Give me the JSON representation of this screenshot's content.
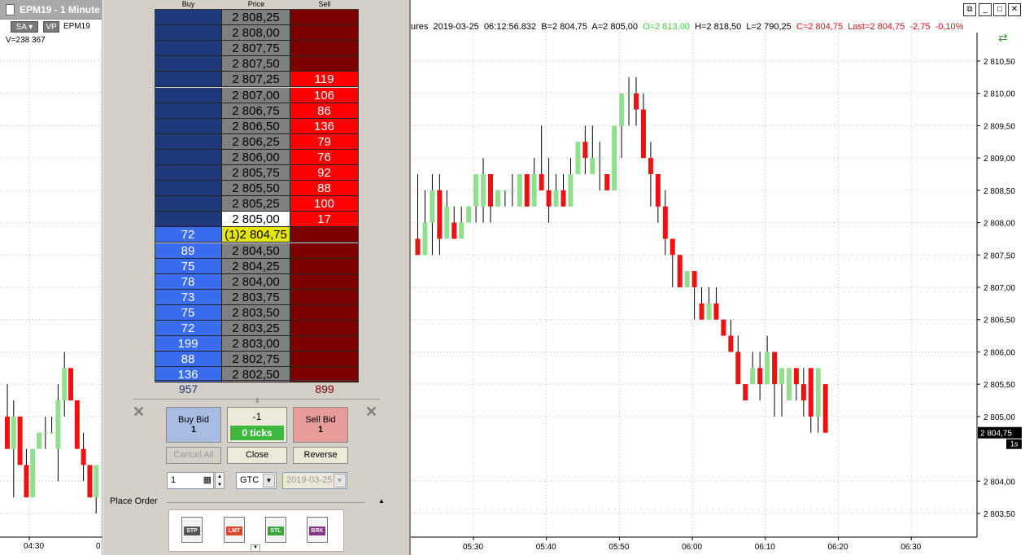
{
  "left_chart": {
    "title": "EPM19 - 1 Minute",
    "btn_sa": "SA",
    "btn_vp": "VP",
    "symbol": "EPM19",
    "volume": "V=238 367",
    "time_labels": [
      "04:30",
      "0"
    ]
  },
  "dom": {
    "headers": {
      "buy": "Buy",
      "price": "Price",
      "sell": "Sell"
    },
    "rows": [
      {
        "buy": "",
        "price": "2 808,25",
        "sell": ""
      },
      {
        "buy": "",
        "price": "2 808,00",
        "sell": ""
      },
      {
        "buy": "",
        "price": "2 807,75",
        "sell": ""
      },
      {
        "buy": "",
        "price": "2 807,50",
        "sell": ""
      },
      {
        "buy": "",
        "price": "2 807,25",
        "sell": "119"
      },
      {
        "buy": "",
        "price": "2 807,00",
        "sell": "106"
      },
      {
        "buy": "",
        "price": "2 806,75",
        "sell": "86"
      },
      {
        "buy": "",
        "price": "2 806,50",
        "sell": "136"
      },
      {
        "buy": "",
        "price": "2 806,25",
        "sell": "79"
      },
      {
        "buy": "",
        "price": "2 806,00",
        "sell": "76"
      },
      {
        "buy": "",
        "price": "2 805,75",
        "sell": "92"
      },
      {
        "buy": "",
        "price": "2 805,50",
        "sell": "88"
      },
      {
        "buy": "",
        "price": "2 805,25",
        "sell": "100"
      },
      {
        "buy": "",
        "price": "2 805,00",
        "sell": "17"
      },
      {
        "buy": "72",
        "price": "(1)2 804,75",
        "sell": ""
      },
      {
        "buy": "89",
        "price": "2 804,50",
        "sell": ""
      },
      {
        "buy": "75",
        "price": "2 804,25",
        "sell": ""
      },
      {
        "buy": "78",
        "price": "2 804,00",
        "sell": ""
      },
      {
        "buy": "73",
        "price": "2 803,75",
        "sell": ""
      },
      {
        "buy": "75",
        "price": "2 803,50",
        "sell": ""
      },
      {
        "buy": "72",
        "price": "2 803,25",
        "sell": ""
      },
      {
        "buy": "199",
        "price": "2 803,00",
        "sell": ""
      },
      {
        "buy": "88",
        "price": "2 802,75",
        "sell": ""
      },
      {
        "buy": "136",
        "price": "2 802,50",
        "sell": ""
      }
    ],
    "total_buy": "957",
    "total_sell": "899",
    "buy_bid": {
      "label": "Buy Bid",
      "qty": "1"
    },
    "sell_bid": {
      "label": "Sell Bid",
      "qty": "1"
    },
    "position": {
      "value": "-1",
      "ticks": "0 ticks"
    },
    "cancel_all": "Cancel All",
    "close": "Close",
    "reverse": "Reverse",
    "quantity": "1",
    "tif": "GTC",
    "date": "2019-03-25",
    "place_order": "Place Order",
    "order_types": [
      "STP",
      "LMT",
      "STL",
      "BRK"
    ],
    "colors": {
      "buy_dark": "#1f3a7a",
      "buy_light": "#3a6cf0",
      "sell_dark": "#7c0000",
      "sell_light": "#ff0000",
      "price_bg": "#808080",
      "last_bg": "#e6e600"
    }
  },
  "main_chart": {
    "info": {
      "prefix": "ures",
      "date": "2019-03-25",
      "time": "06:12:56.832",
      "bid": "B=2 804,75",
      "ask": "A=2 805,00",
      "open": "O=2 813,00",
      "high": "H=2 818,50",
      "low": "L=2 790,25",
      "close": "C=2 804,75",
      "last": "Last=2 804,75",
      "change": "-2,75",
      "pct": "-0,10%"
    },
    "price_labels": [
      "2 810,50",
      "2 810,00",
      "2 809,50",
      "2 809,00",
      "2 808,50",
      "2 808,00",
      "2 807,50",
      "2 807,00",
      "2 806,50",
      "2 806,00",
      "2 805,50",
      "2 805,00",
      "2 804,00",
      "2 803,50"
    ],
    "price_values": [
      2810.5,
      2810.0,
      2809.5,
      2809.0,
      2808.5,
      2808.0,
      2807.5,
      2807.0,
      2806.5,
      2806.0,
      2805.5,
      2805.0,
      2804.0,
      2803.5
    ],
    "last_tag": "2 804,75",
    "time_tag": "1s",
    "time_labels": [
      "05:30",
      "05:40",
      "05:50",
      "06:00",
      "06:10",
      "06:20",
      "06:30"
    ]
  },
  "chart_data": {
    "type": "candlestick",
    "yrange": [
      2803.0,
      2811.0
    ],
    "candles": [
      {
        "o": 2807.75,
        "h": 2808.75,
        "l": 2807.5,
        "c": 2807.5
      },
      {
        "o": 2807.5,
        "h": 2808.5,
        "l": 2807.5,
        "c": 2808.0
      },
      {
        "o": 2808.0,
        "h": 2808.75,
        "l": 2807.5,
        "c": 2808.5
      },
      {
        "o": 2808.5,
        "h": 2808.75,
        "l": 2807.5,
        "c": 2807.75
      },
      {
        "o": 2807.75,
        "h": 2808.5,
        "l": 2807.75,
        "c": 2808.25
      },
      {
        "o": 2808.0,
        "h": 2808.25,
        "l": 2807.75,
        "c": 2807.75
      },
      {
        "o": 2807.75,
        "h": 2808.25,
        "l": 2807.75,
        "c": 2808.0
      },
      {
        "o": 2808.0,
        "h": 2808.25,
        "l": 2808.0,
        "c": 2808.25
      },
      {
        "o": 2808.25,
        "h": 2808.75,
        "l": 2808.0,
        "c": 2808.75
      },
      {
        "o": 2808.25,
        "h": 2809.0,
        "l": 2808.0,
        "c": 2808.75
      },
      {
        "o": 2808.75,
        "h": 2808.75,
        "l": 2808.0,
        "c": 2808.25
      },
      {
        "o": 2808.25,
        "h": 2808.5,
        "l": 2808.25,
        "c": 2808.5
      },
      {
        "o": 2808.5,
        "h": 2808.5,
        "l": 2808.25,
        "c": 2808.5
      },
      {
        "o": 2808.5,
        "h": 2808.75,
        "l": 2808.25,
        "c": 2808.5
      },
      {
        "o": 2808.25,
        "h": 2808.75,
        "l": 2808.25,
        "c": 2808.75
      },
      {
        "o": 2808.75,
        "h": 2808.75,
        "l": 2808.25,
        "c": 2808.25
      },
      {
        "o": 2808.25,
        "h": 2809.0,
        "l": 2808.25,
        "c": 2808.75
      },
      {
        "o": 2808.75,
        "h": 2809.5,
        "l": 2808.5,
        "c": 2808.5
      },
      {
        "o": 2808.5,
        "h": 2809.0,
        "l": 2808.0,
        "c": 2808.25
      },
      {
        "o": 2808.25,
        "h": 2808.75,
        "l": 2808.25,
        "c": 2808.5
      },
      {
        "o": 2808.5,
        "h": 2808.75,
        "l": 2808.25,
        "c": 2808.25
      },
      {
        "o": 2808.25,
        "h": 2809.0,
        "l": 2808.25,
        "c": 2808.75
      },
      {
        "o": 2808.75,
        "h": 2809.25,
        "l": 2808.75,
        "c": 2809.25
      },
      {
        "o": 2809.25,
        "h": 2809.5,
        "l": 2808.75,
        "c": 2809.0
      },
      {
        "o": 2808.75,
        "h": 2809.5,
        "l": 2808.75,
        "c": 2809.0
      },
      {
        "o": 2809.0,
        "h": 2809.25,
        "l": 2808.5,
        "c": 2809.0
      },
      {
        "o": 2808.75,
        "h": 2808.75,
        "l": 2808.5,
        "c": 2808.5
      },
      {
        "o": 2808.5,
        "h": 2809.25,
        "l": 2808.5,
        "c": 2809.5
      },
      {
        "o": 2809.5,
        "h": 2810.0,
        "l": 2809.0,
        "c": 2810.0
      },
      {
        "o": 2810.0,
        "h": 2810.25,
        "l": 2809.5,
        "c": 2810.0
      },
      {
        "o": 2810.0,
        "h": 2810.25,
        "l": 2809.5,
        "c": 2809.75
      },
      {
        "o": 2809.75,
        "h": 2810.0,
        "l": 2809.0,
        "c": 2809.0
      },
      {
        "o": 2809.0,
        "h": 2809.25,
        "l": 2808.25,
        "c": 2808.75
      },
      {
        "o": 2808.75,
        "h": 2808.75,
        "l": 2808.0,
        "c": 2808.25
      },
      {
        "o": 2808.25,
        "h": 2808.5,
        "l": 2807.5,
        "c": 2807.75
      },
      {
        "o": 2807.75,
        "h": 2807.75,
        "l": 2807.0,
        "c": 2807.5
      },
      {
        "o": 2807.5,
        "h": 2807.5,
        "l": 2807.0,
        "c": 2807.0
      },
      {
        "o": 2807.0,
        "h": 2807.25,
        "l": 2807.0,
        "c": 2807.25
      },
      {
        "o": 2807.25,
        "h": 2807.25,
        "l": 2806.5,
        "c": 2807.0
      },
      {
        "o": 2806.75,
        "h": 2807.0,
        "l": 2806.5,
        "c": 2806.5
      },
      {
        "o": 2806.5,
        "h": 2807.0,
        "l": 2806.5,
        "c": 2806.75
      },
      {
        "o": 2806.75,
        "h": 2807.0,
        "l": 2806.5,
        "c": 2806.5
      },
      {
        "o": 2806.5,
        "h": 2806.5,
        "l": 2806.25,
        "c": 2806.25
      },
      {
        "o": 2806.25,
        "h": 2806.5,
        "l": 2806.0,
        "c": 2806.0
      },
      {
        "o": 2806.0,
        "h": 2806.25,
        "l": 2805.5,
        "c": 2805.5
      },
      {
        "o": 2805.5,
        "h": 2805.5,
        "l": 2805.25,
        "c": 2805.25
      },
      {
        "o": 2805.5,
        "h": 2806.0,
        "l": 2805.5,
        "c": 2805.75
      },
      {
        "o": 2805.75,
        "h": 2806.0,
        "l": 2805.25,
        "c": 2805.5
      },
      {
        "o": 2805.5,
        "h": 2806.25,
        "l": 2805.5,
        "c": 2806.0
      },
      {
        "o": 2806.0,
        "h": 2806.0,
        "l": 2805.0,
        "c": 2805.5
      },
      {
        "o": 2805.5,
        "h": 2805.75,
        "l": 2805.0,
        "c": 2805.75
      },
      {
        "o": 2805.25,
        "h": 2805.75,
        "l": 2805.25,
        "c": 2805.75
      },
      {
        "o": 2805.75,
        "h": 2805.75,
        "l": 2805.25,
        "c": 2805.5
      },
      {
        "o": 2805.5,
        "h": 2805.75,
        "l": 2805.0,
        "c": 2805.25
      },
      {
        "o": 2805.75,
        "h": 2805.75,
        "l": 2804.75,
        "c": 2805.0
      },
      {
        "o": 2805.0,
        "h": 2805.75,
        "l": 2804.75,
        "c": 2805.75
      },
      {
        "o": 2805.5,
        "h": 2805.5,
        "l": 2804.75,
        "c": 2804.75
      }
    ],
    "left_candles": [
      {
        "o": 2805.0,
        "h": 2805.5,
        "l": 2804.5,
        "c": 2804.5
      },
      {
        "o": 2804.5,
        "h": 2805.25,
        "l": 2803.75,
        "c": 2805.0
      },
      {
        "o": 2805.0,
        "h": 2805.0,
        "l": 2804.25,
        "c": 2804.25
      },
      {
        "o": 2804.25,
        "h": 2804.5,
        "l": 2803.75,
        "c": 2803.75
      },
      {
        "o": 2803.75,
        "h": 2804.5,
        "l": 2803.75,
        "c": 2804.5
      },
      {
        "o": 2804.5,
        "h": 2804.75,
        "l": 2804.5,
        "c": 2804.75
      },
      {
        "o": 2804.75,
        "h": 2805.0,
        "l": 2804.5,
        "c": 2804.75
      },
      {
        "o": 2804.75,
        "h": 2805.0,
        "l": 2804.75,
        "c": 2804.75
      },
      {
        "o": 2804.5,
        "h": 2805.5,
        "l": 2804.0,
        "c": 2805.25
      },
      {
        "o": 2805.25,
        "h": 2806.0,
        "l": 2805.0,
        "c": 2805.75
      },
      {
        "o": 2805.75,
        "h": 2805.75,
        "l": 2805.25,
        "c": 2805.25
      },
      {
        "o": 2805.25,
        "h": 2805.25,
        "l": 2804.5,
        "c": 2804.5
      },
      {
        "o": 2804.5,
        "h": 2804.75,
        "l": 2804.0,
        "c": 2804.25
      },
      {
        "o": 2804.25,
        "h": 2804.25,
        "l": 2803.75,
        "c": 2803.75
      },
      {
        "o": 2803.75,
        "h": 2804.25,
        "l": 2803.5,
        "c": 2804.25
      }
    ]
  }
}
